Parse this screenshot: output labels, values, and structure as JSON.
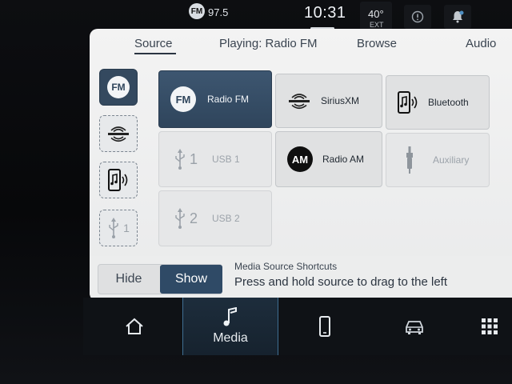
{
  "status": {
    "radio_badge": "FM",
    "radio_freq": "97.5",
    "time": "10:31",
    "temperature": "40°",
    "temp_label": "EXT"
  },
  "tabs": [
    {
      "label": "Source"
    },
    {
      "label": "Playing: Radio FM"
    },
    {
      "label": "Browse"
    },
    {
      "label": "Audio"
    }
  ],
  "shortcuts": [
    {
      "icon": "fm-icon",
      "text": "FM"
    },
    {
      "icon": "siriusxm-icon",
      "text": ""
    },
    {
      "icon": "bluetooth-phone-icon",
      "text": ""
    },
    {
      "icon": "usb-icon",
      "text": "1"
    }
  ],
  "sources": [
    {
      "label": "Radio FM",
      "icon": "fm-icon",
      "badge": "FM",
      "state": "selected"
    },
    {
      "label": "SiriusXM",
      "icon": "siriusxm-icon",
      "state": "normal"
    },
    {
      "label": "Bluetooth",
      "icon": "bluetooth-phone-icon",
      "state": "normal"
    },
    {
      "label": "USB 1",
      "icon": "usb-icon",
      "num": "1",
      "state": "disabled"
    },
    {
      "label": "Radio AM",
      "icon": "am-icon",
      "badge": "AM",
      "state": "normal"
    },
    {
      "label": "Auxiliary",
      "icon": "aux-icon",
      "state": "disabled"
    },
    {
      "label": "USB 2",
      "icon": "usb-icon",
      "num": "2",
      "state": "disabled"
    }
  ],
  "toggle": {
    "hide": "Hide",
    "show": "Show"
  },
  "hint": {
    "title": "Media Source Shortcuts",
    "text": "Press and hold source to drag to the left"
  },
  "nav": [
    {
      "icon": "home-icon",
      "label": ""
    },
    {
      "icon": "music-note-icon",
      "label": "Media"
    },
    {
      "icon": "phone-icon",
      "label": ""
    },
    {
      "icon": "vehicle-icon",
      "label": ""
    },
    {
      "icon": "apps-grid-icon",
      "label": ""
    }
  ]
}
